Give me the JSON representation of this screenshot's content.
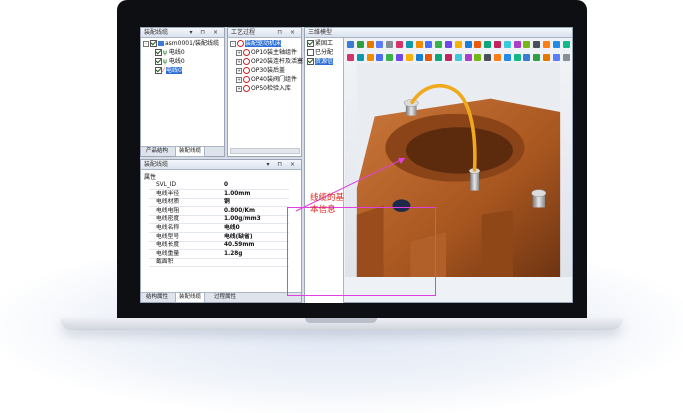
{
  "windows": {
    "assembly": {
      "title": "装配线缆"
    },
    "process": {
      "title": "工艺过程"
    },
    "model": {
      "title": "三维模型"
    },
    "props": {
      "title": "装配线缆",
      "group": "属性"
    }
  },
  "assembly_tree": {
    "root": "asm0001/装配线缆",
    "items": [
      "电线0",
      "电线0",
      "电线0"
    ]
  },
  "assembly_tabs": [
    "产品结构",
    "装配线缆"
  ],
  "process_tree": {
    "root": "装配驱动机床",
    "items": [
      "OP10装主轴组件",
      "OP20装连杆及活塞",
      "OP30装后盖",
      "OP40装阀门组件",
      "OP50检验入库"
    ]
  },
  "model_tree": {
    "items": [
      "紧固工",
      "已分配",
      "资源信"
    ]
  },
  "properties": [
    {
      "key": "SVL_ID",
      "value": "0"
    },
    {
      "key": "电线半径",
      "value": "1.00mm"
    },
    {
      "key": "电线材质",
      "value": "铜"
    },
    {
      "key": "电线电阻",
      "value": "0.800/Km"
    },
    {
      "key": "电线密度",
      "value": "1.00g/mm3"
    },
    {
      "key": "电线名称",
      "value": "电线0"
    },
    {
      "key": "电线型号",
      "value": "电线(缺省)"
    },
    {
      "key": "电线长度",
      "value": "40.59mm"
    },
    {
      "key": "电线重量",
      "value": "1.28g"
    },
    {
      "key": "截面积",
      "value": ""
    }
  ],
  "props_tabs": [
    "结构属性",
    "装配线缆",
    "过程属性"
  ],
  "annotation": {
    "line1": "线缆的基",
    "line2": "本信息"
  },
  "colors": {
    "accent": "#2b6fd6",
    "annotation": "#e0261b",
    "highlight": "#e040e0",
    "cable": "#f0a91c",
    "casting": "#b8652e"
  }
}
